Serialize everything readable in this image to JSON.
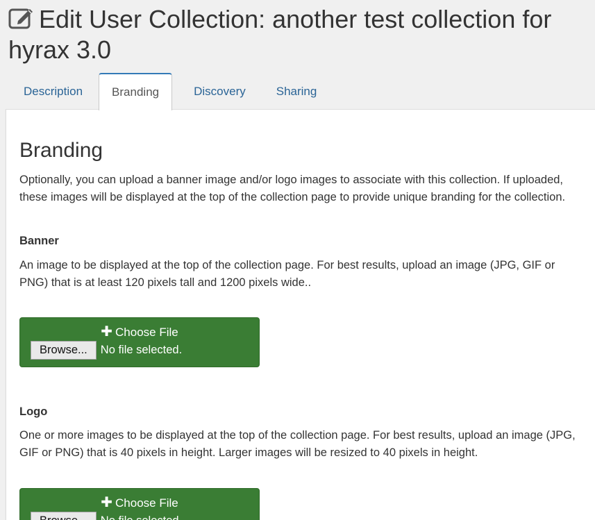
{
  "header": {
    "title": "Edit User Collection: another test collection for hyrax 3.0",
    "icon": "edit-icon"
  },
  "tabs": [
    {
      "label": "Description",
      "active": false
    },
    {
      "label": "Branding",
      "active": true
    },
    {
      "label": "Discovery",
      "active": false
    },
    {
      "label": "Sharing",
      "active": false
    }
  ],
  "branding": {
    "heading": "Branding",
    "intro": "Optionally, you can upload a banner image and/or logo images to associate with this collection. If uploaded, these images will be displayed at the top of the collection page to provide unique branding for the collection.",
    "banner": {
      "label": "Banner",
      "description": "An image to be displayed at the top of the collection page. For best results, upload an image (JPG, GIF or PNG) that is at least 120 pixels tall and 1200 pixels wide..",
      "choose_label": "Choose File",
      "browse_label": "Browse...",
      "file_status": "No file selected."
    },
    "logo": {
      "label": "Logo",
      "description": "One or more images to be displayed at the top of the collection page. For best results, upload an image (JPG, GIF or PNG) that is 40 pixels in height. Larger images will be resized to 40 pixels in height.",
      "choose_label": "Choose File",
      "browse_label": "Browse...",
      "file_status": "No file selected."
    }
  },
  "colors": {
    "link": "#2a6496",
    "upload_button": "#3a7d34",
    "page_background": "#f0f0f0"
  }
}
